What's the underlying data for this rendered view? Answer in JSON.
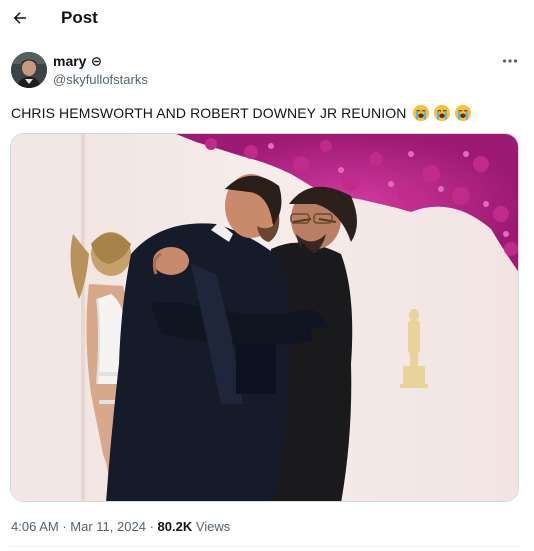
{
  "header": {
    "title": "Post",
    "back_icon": "arrow-left-icon"
  },
  "author": {
    "display_name": "mary",
    "badge_icon": "circle-badge-icon",
    "handle": "@skyfullofstarks",
    "avatar_icon": "profile-photo-avatar"
  },
  "more_icon": "more-horizontal-icon",
  "tweet": {
    "text": "CHRIS HEMSWORTH AND ROBERT DOWNEY JR REUNION",
    "emojis": [
      "loudly-crying-face-icon",
      "loudly-crying-face-icon",
      "loudly-crying-face-icon"
    ]
  },
  "media": {
    "kind": "photo",
    "colors": {
      "backdrop": "#f3e8e6",
      "flowers": "#b8208a",
      "suit": "#151a28",
      "statue": "#ead7a2"
    }
  },
  "meta": {
    "time": "4:06 AM",
    "sep1": "·",
    "date": "Mar 11, 2024",
    "sep2": "·",
    "views_count": "80.2K",
    "views_label": "Views"
  },
  "colors": {
    "text": "#0f1419",
    "secondary": "#536471",
    "border": "#cfd9de"
  }
}
